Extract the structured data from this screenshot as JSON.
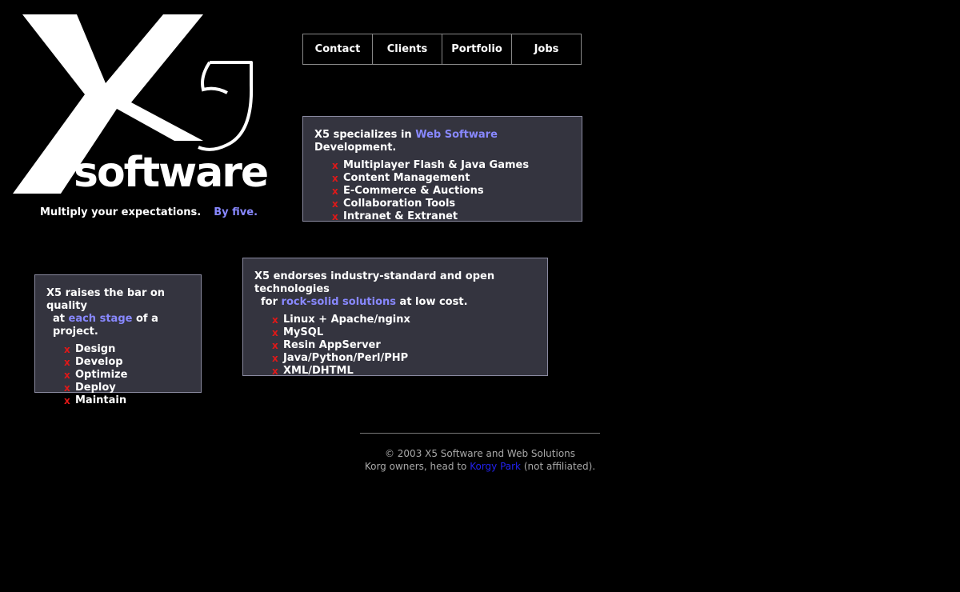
{
  "logo": {
    "mark": "X5",
    "word": "software"
  },
  "tagline": {
    "text": "Multiply your expectations.",
    "accent": "By five."
  },
  "nav": [
    {
      "label": "Contact"
    },
    {
      "label": "Clients"
    },
    {
      "label": "Portfolio"
    },
    {
      "label": "Jobs"
    }
  ],
  "specializes": {
    "lead": "X5 specializes in ",
    "highlight": "Web Software",
    "tail": " Development.",
    "items": [
      "Multiplayer Flash & Java Games",
      "Content Management",
      "E-Commerce & Auctions",
      "Collaboration Tools",
      "Intranet & Extranet"
    ]
  },
  "endorses": {
    "line1": "X5 endorses industry-standard and open technologies",
    "lead2": "for ",
    "highlight": "rock-solid solutions",
    "tail2": " at low cost.",
    "items": [
      "Linux + Apache/nginx",
      "MySQL",
      "Resin AppServer",
      "Java/Python/Perl/PHP",
      "XML/DHTML"
    ]
  },
  "quality": {
    "line1": "X5 raises the bar on quality",
    "lead2": "at ",
    "highlight": "each stage",
    "tail2": " of a project.",
    "items": [
      "Design",
      "Develop",
      "Optimize",
      "Deploy",
      "Maintain"
    ]
  },
  "bullet": "x",
  "footer": {
    "copyright": "© 2003 X5 Software and Web Solutions",
    "lead": "Korg owners, head to ",
    "link": "Korgy Park",
    "tail": " (not affiliated)."
  },
  "colors": {
    "background": "#000000",
    "box": "#34343f",
    "highlight": "#8888ff",
    "bullet": "#e01818",
    "link": "#2222ee"
  }
}
